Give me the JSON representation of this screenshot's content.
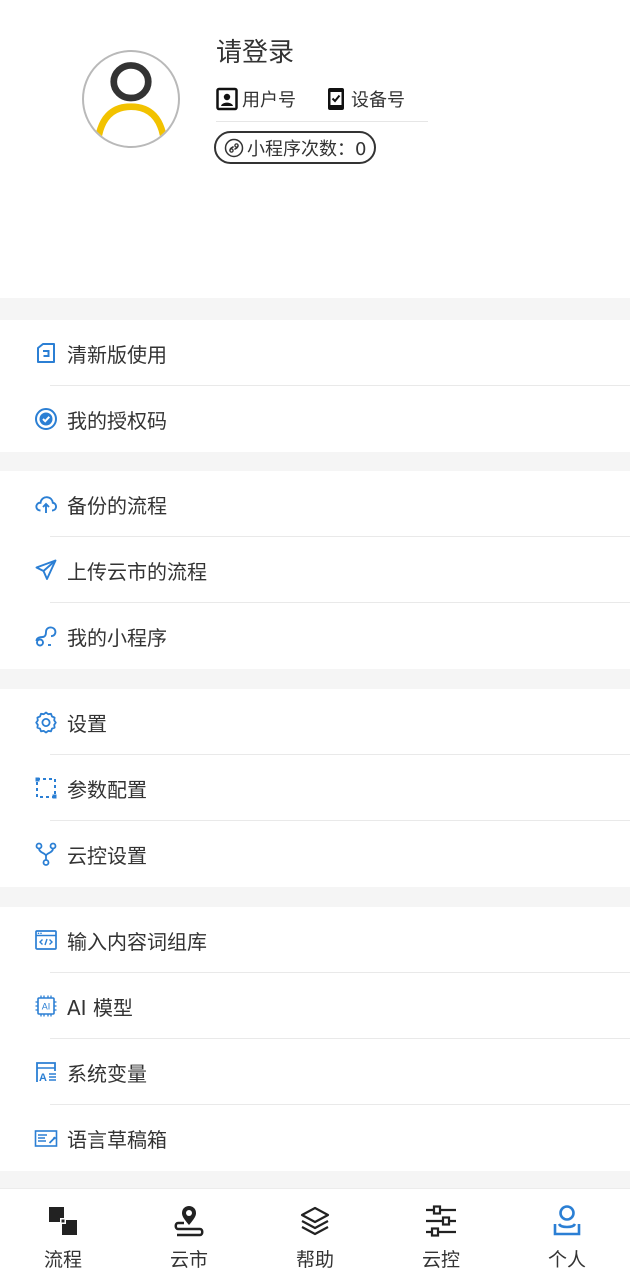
{
  "profile": {
    "title": "请登录",
    "user_id_label": "用户号",
    "device_id_label": "设备号",
    "mini_program_count": "小程序次数：0"
  },
  "menu_groups": [
    {
      "items": [
        {
          "label": "清新版使用",
          "icon": "fresh-version-icon"
        },
        {
          "label": "我的授权码",
          "icon": "license-badge-icon"
        }
      ]
    },
    {
      "items": [
        {
          "label": "备份的流程",
          "icon": "cloud-backup-icon"
        },
        {
          "label": "上传云市的流程",
          "icon": "paper-plane-icon"
        },
        {
          "label": "我的小程序",
          "icon": "mini-program-icon"
        }
      ]
    },
    {
      "items": [
        {
          "label": "设置",
          "icon": "gear-icon"
        },
        {
          "label": "参数配置",
          "icon": "dashed-frame-icon"
        },
        {
          "label": "云控设置",
          "icon": "branch-icon"
        }
      ]
    },
    {
      "items": [
        {
          "label": "输入内容词组库",
          "icon": "code-window-icon"
        },
        {
          "label": "AI 模型",
          "icon": "ai-chip-icon"
        },
        {
          "label": "系统变量",
          "icon": "variable-icon"
        },
        {
          "label": "语言草稿箱",
          "icon": "draft-icon"
        }
      ]
    }
  ],
  "tabbar": {
    "items": [
      {
        "label": "流程",
        "icon": "flow-icon"
      },
      {
        "label": "云市",
        "icon": "location-route-icon"
      },
      {
        "label": "帮助",
        "icon": "layers-icon"
      },
      {
        "label": "云控",
        "icon": "sliders-icon"
      },
      {
        "label": "个人",
        "icon": "person-icon"
      }
    ],
    "active_index": 4
  },
  "colors": {
    "accent": "#2b7fd4",
    "avatar_yellow": "#f2c200",
    "text": "#333333",
    "background": "#f5f5f5"
  }
}
